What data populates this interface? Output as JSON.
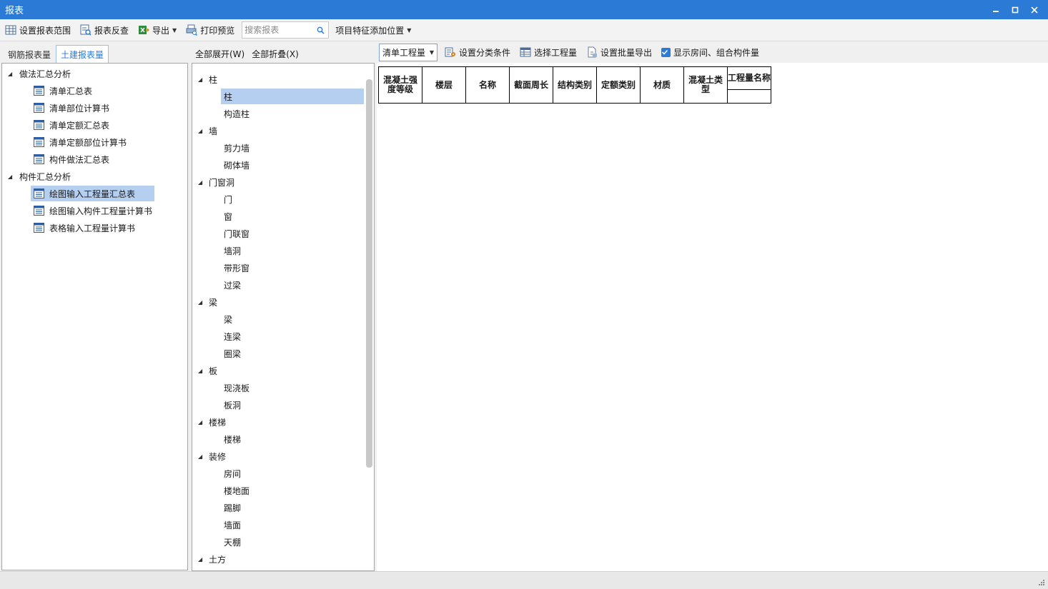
{
  "window": {
    "title": "报表",
    "minimize_icon": "minimize-icon",
    "maximize_icon": "maximize-icon",
    "close_icon": "close-icon"
  },
  "toolbar": {
    "set_range": "设置报表范围",
    "reverse_check": "报表反查",
    "export": "导出",
    "print_preview": "打印预览",
    "search_placeholder": "搜索报表",
    "feature_position": "项目特征添加位置"
  },
  "left_panel": {
    "tabs": [
      "钢筋报表量",
      "土建报表量"
    ],
    "active_tab": 1,
    "groups": [
      {
        "label": "做法汇总分析",
        "items": [
          "清单汇总表",
          "清单部位计算书",
          "清单定额汇总表",
          "清单定额部位计算书",
          "构件做法汇总表"
        ]
      },
      {
        "label": "构件汇总分析",
        "items": [
          "绘图输入工程量汇总表",
          "绘图输入构件工程量计算书",
          "表格输入工程量计算书"
        ]
      }
    ],
    "selected_item": "绘图输入工程量汇总表"
  },
  "middle_panel": {
    "expand_all": "全部展开(W)",
    "collapse_all": "全部折叠(X)",
    "categories": [
      {
        "label": "柱",
        "items": [
          "柱",
          "构造柱"
        ]
      },
      {
        "label": "墙",
        "items": [
          "剪力墙",
          "砌体墙"
        ]
      },
      {
        "label": "门窗洞",
        "items": [
          "门",
          "窗",
          "门联窗",
          "墙洞",
          "带形窗",
          "过梁"
        ]
      },
      {
        "label": "梁",
        "items": [
          "梁",
          "连梁",
          "圈梁"
        ]
      },
      {
        "label": "板",
        "items": [
          "现浇板",
          "板洞"
        ]
      },
      {
        "label": "楼梯",
        "items": [
          "楼梯"
        ]
      },
      {
        "label": "装修",
        "items": [
          "房间",
          "楼地面",
          "踢脚",
          "墙面",
          "天棚"
        ]
      },
      {
        "label": "土方",
        "items": []
      }
    ],
    "selected_item": "柱"
  },
  "right_panel": {
    "combo_value": "清单工程量",
    "set_category": "设置分类条件",
    "select_quantity": "选择工程量",
    "batch_export": "设置批量导出",
    "show_rooms_label": "显示房间、组合构件量",
    "show_rooms_checked": true,
    "table_headers": [
      "混凝土强度等级",
      "楼层",
      "名称",
      "截面周长",
      "结构类别",
      "定额类别",
      "材质",
      "混凝土类型",
      "工程量名称"
    ]
  }
}
